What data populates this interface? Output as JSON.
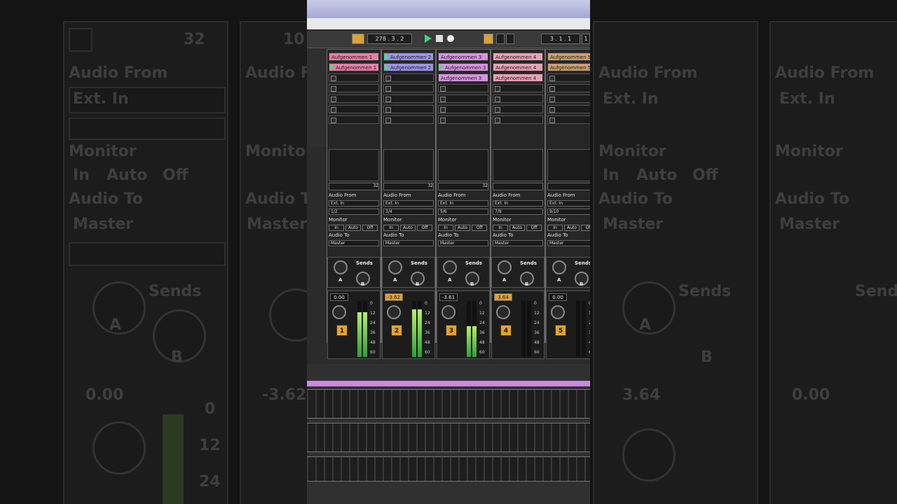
{
  "transport": {
    "position_left": "278 . 3 . 2",
    "position_right": "3 . 1 . 1",
    "position_right_cont": "1"
  },
  "tracks": [
    {
      "clips": [
        {
          "label": "Aufgenommen 1",
          "color": "#e47fa6"
        },
        {
          "label": "Aufgenommen 1",
          "color": "#e47fa6"
        }
      ],
      "launch": [
        false,
        true
      ],
      "pan": "32",
      "audio_from_label": "Audio From",
      "audio_from": "Ext. In",
      "input_channel": "1/2",
      "monitor_label": "Monitor",
      "monitor_options": [
        "In",
        "Auto",
        "Off"
      ],
      "audio_to_label": "Audio To",
      "audio_to": "Master",
      "sends_label": "Sends",
      "sends_a": "A",
      "sends_b": "B",
      "volume": "0.00",
      "volume_hot": false,
      "number": "1",
      "meter_level": 0.8
    },
    {
      "clips": [
        {
          "label": "Aufgenommen 2",
          "color": "#9b93e6"
        },
        {
          "label": "Aufgenommen 2",
          "color": "#9b93e6"
        }
      ],
      "launch": [
        true,
        true
      ],
      "pan": "32",
      "audio_from_label": "Audio From",
      "audio_from": "Ext. In",
      "input_channel": "3/4",
      "monitor_label": "Monitor",
      "monitor_options": [
        "In",
        "Auto",
        "Off"
      ],
      "audio_to_label": "Audio To",
      "audio_to": "Master",
      "sends_label": "Sends",
      "sends_a": "A",
      "sends_b": "B",
      "volume": "-3.62",
      "volume_hot": true,
      "number": "2",
      "meter_level": 0.85
    },
    {
      "clips": [
        {
          "label": "Aufgenommen 3",
          "color": "#d791e0"
        },
        {
          "label": "Aufgenommen 3",
          "color": "#d791e0"
        },
        {
          "label": "Aufgenommen 3",
          "color": "#d791e0"
        }
      ],
      "launch": [
        false,
        true,
        false
      ],
      "pan": "32",
      "audio_from_label": "Audio From",
      "audio_from": "Ext. In",
      "input_channel": "5/6",
      "monitor_label": "Monitor",
      "monitor_options": [
        "In",
        "Auto",
        "Off"
      ],
      "audio_to_label": "Audio To",
      "audio_to": "Master",
      "sends_label": "Sends",
      "sends_a": "A",
      "sends_b": "B",
      "volume": "-3.61",
      "volume_hot": false,
      "number": "3",
      "meter_level": 0.55
    },
    {
      "clips": [
        {
          "label": "Aufgenommen 4",
          "color": "#e8a0b6"
        },
        {
          "label": "Aufgenommen 4",
          "color": "#e8a0b6"
        },
        {
          "label": "Aufgenommen 4",
          "color": "#e8a0b6"
        }
      ],
      "launch": [
        false,
        false,
        false
      ],
      "pan": "",
      "audio_from_label": "Audio From",
      "audio_from": "Ext. In",
      "input_channel": "7/8",
      "monitor_label": "Monitor",
      "monitor_options": [
        "In",
        "Auto",
        "Off"
      ],
      "audio_to_label": "Audio To",
      "audio_to": "Master",
      "sends_label": "Sends",
      "sends_a": "A",
      "sends_b": "B",
      "volume": "3.64",
      "volume_hot": true,
      "number": "4",
      "meter_level": 0.0
    },
    {
      "clips": [
        {
          "label": "Aufgenommen 5",
          "color": "#c9a070"
        },
        {
          "label": "Aufgenommen 5",
          "color": "#c9a070"
        }
      ],
      "launch": [
        false,
        false
      ],
      "pan": "",
      "audio_from_label": "Audio From",
      "audio_from": "Ext. In",
      "input_channel": "9/10",
      "monitor_label": "Monitor",
      "monitor_options": [
        "In",
        "Auto",
        "Off"
      ],
      "audio_to_label": "Audio To",
      "audio_to": "Master",
      "sends_label": "Sends",
      "sends_a": "A",
      "sends_b": "B",
      "volume": "0.00",
      "volume_hot": false,
      "number": "5",
      "meter_level": 0.0
    }
  ],
  "meter_scale": [
    "0",
    "12",
    "24",
    "36",
    "48",
    "60"
  ],
  "background": {
    "audio_from": "Audio From",
    "ext_in": "Ext. In",
    "monitor": "Monitor",
    "monitor_in": "In",
    "monitor_auto": "Auto",
    "monitor_off": "Off",
    "audio_to": "Audio To",
    "master": "Master",
    "sends": "Sends",
    "send_a": "A",
    "send_b": "B",
    "vol_left": "0.00",
    "vol_mid": "-3.62",
    "vol_right_a": "3.64",
    "vol_right_b": "0.00",
    "scale_0": "0",
    "scale_12": "12",
    "scale_24": "24",
    "num_32": "32",
    "num_10": "10"
  }
}
